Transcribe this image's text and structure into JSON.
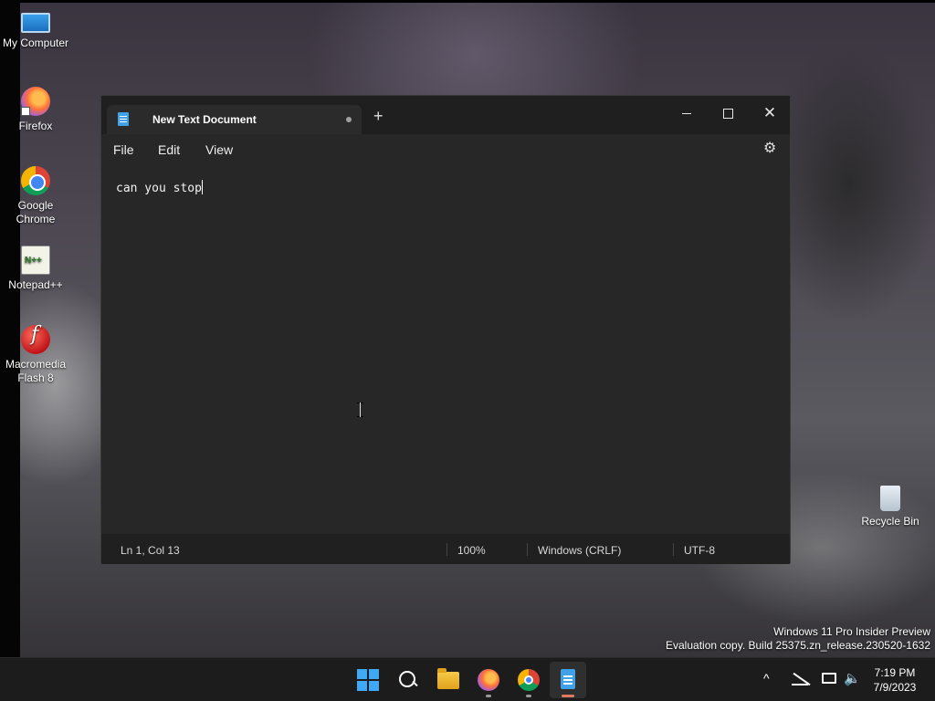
{
  "desktop": {
    "icons": [
      {
        "label": "My Computer"
      },
      {
        "label": "Firefox"
      },
      {
        "label": "Google Chrome"
      },
      {
        "label": "Notepad++"
      },
      {
        "label": "Macromedia Flash 8"
      },
      {
        "label": "Recycle Bin"
      }
    ],
    "watermark": {
      "line1": "Windows 11 Pro Insider Preview",
      "line2": "Evaluation copy. Build 25375.zn_release.230520-1632"
    }
  },
  "notepad": {
    "tab_title": "New Text Document",
    "new_tab_symbol": "+",
    "close_symbol": "✕",
    "menu": {
      "file": "File",
      "edit": "Edit",
      "view": "View"
    },
    "settings_symbol": "⚙",
    "content": "can you stop",
    "status": {
      "position": "Ln 1, Col 13",
      "zoom": "100%",
      "line_ending": "Windows (CRLF)",
      "encoding": "UTF-8"
    }
  },
  "taskbar": {
    "chevron_symbol": "^",
    "volume_symbol": "🔈",
    "time": "7:19 PM",
    "date": "7/9/2023"
  }
}
